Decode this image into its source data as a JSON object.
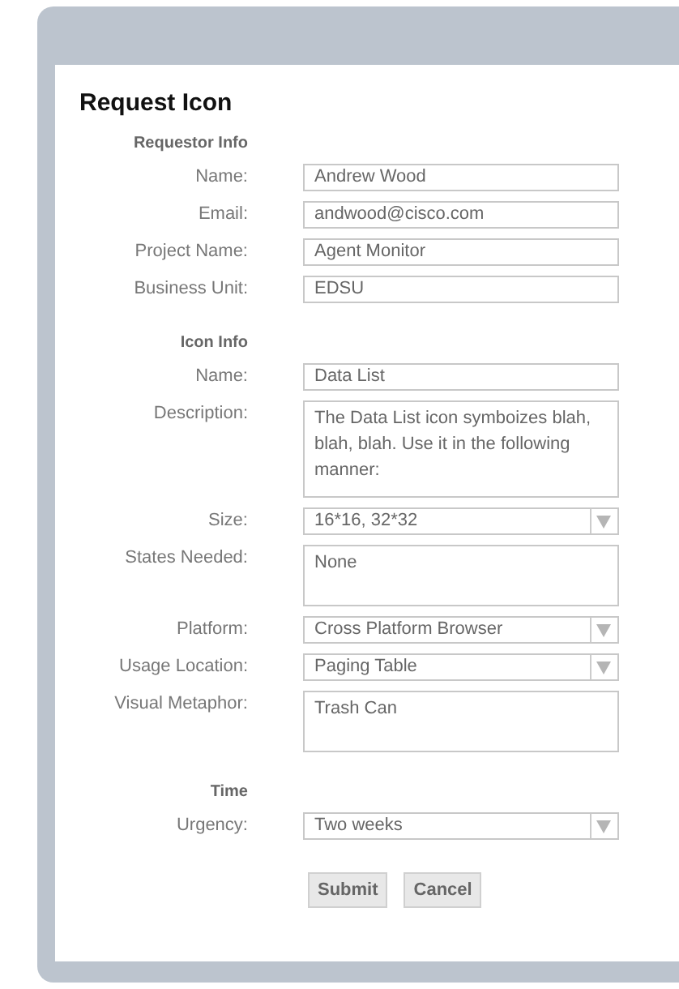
{
  "title": "Request Icon",
  "sections": [
    {
      "heading": "Requestor Info",
      "fields": [
        {
          "kind": "text",
          "label": "Name:",
          "value": "Andrew Wood"
        },
        {
          "kind": "text",
          "label": "Email:",
          "value": "andwood@cisco.com"
        },
        {
          "kind": "text",
          "label": "Project Name:",
          "value": "Agent Monitor"
        },
        {
          "kind": "text",
          "label": "Business Unit:",
          "value": "EDSU"
        }
      ]
    },
    {
      "heading": "Icon Info",
      "fields": [
        {
          "kind": "text",
          "label": "Name:",
          "value": "Data List"
        },
        {
          "kind": "textarea",
          "label": "Description:",
          "value": "The Data List icon symboizes blah, blah, blah. Use it in the following manner:"
        },
        {
          "kind": "select",
          "label": "Size:",
          "value": "16*16, 32*32"
        },
        {
          "kind": "textarea",
          "label": "States Needed:",
          "value": "None"
        },
        {
          "kind": "select",
          "label": "Platform:",
          "value": "Cross Platform Browser"
        },
        {
          "kind": "select",
          "label": "Usage Location:",
          "value": "Paging Table"
        },
        {
          "kind": "textarea",
          "label": "Visual Metaphor:",
          "value": "Trash Can"
        }
      ]
    },
    {
      "heading": "Time",
      "fields": [
        {
          "kind": "select",
          "label": "Urgency:",
          "value": "Two weeks"
        }
      ]
    }
  ],
  "buttons": [
    "Submit",
    "Cancel"
  ]
}
